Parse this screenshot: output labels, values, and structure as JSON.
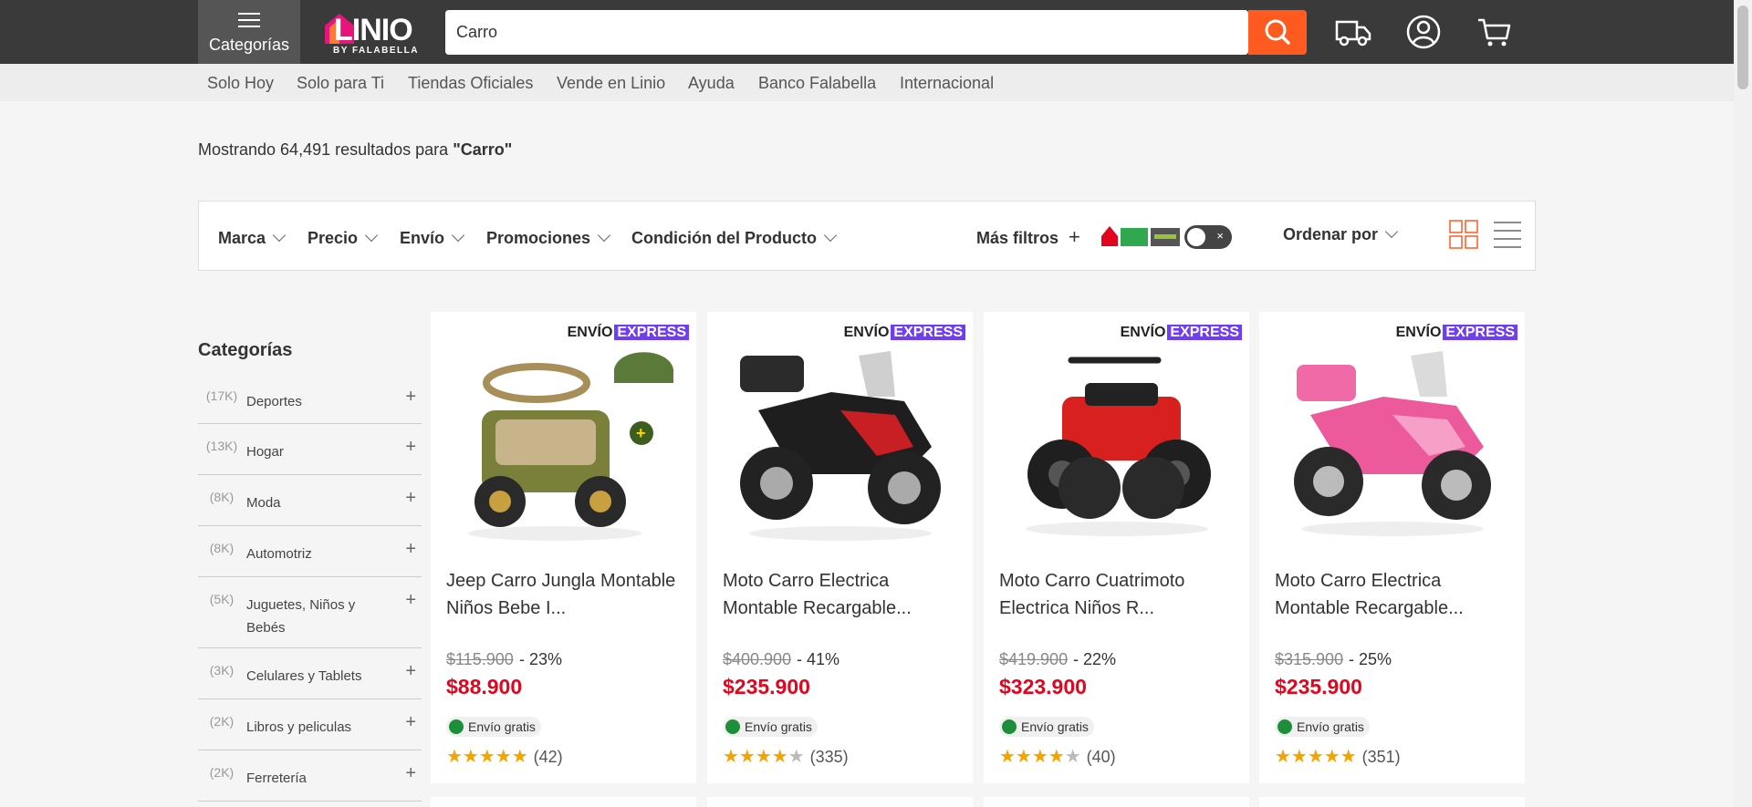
{
  "header": {
    "categories_label": "Categorías",
    "logo_text": "LINIO",
    "logo_sub": "BY FALABELLA",
    "search_value": "Carro"
  },
  "subnav": [
    "Solo Hoy",
    "Solo para Ti",
    "Tiendas Oficiales",
    "Vende en Linio",
    "Ayuda",
    "Banco Falabella",
    "Internacional"
  ],
  "results": {
    "prefix": "Mostrando 64,491 resultados para ",
    "query": "\"Carro\""
  },
  "filters": {
    "items": [
      "Marca",
      "Precio",
      "Envío",
      "Promociones",
      "Condición del Producto"
    ],
    "more": "Más filtros",
    "toggle_x": "×",
    "sort": "Ordenar por"
  },
  "sidebar": {
    "title": "Categorías",
    "items": [
      {
        "count": "(17K)",
        "name": "Deportes"
      },
      {
        "count": "(13K)",
        "name": "Hogar"
      },
      {
        "count": "(8K)",
        "name": "Moda"
      },
      {
        "count": "(8K)",
        "name": "Automotriz"
      },
      {
        "count": "(5K)",
        "name": "Juguetes, Niños y Bebés"
      },
      {
        "count": "(3K)",
        "name": "Celulares y Tablets"
      },
      {
        "count": "(2K)",
        "name": "Libros y peliculas"
      },
      {
        "count": "(2K)",
        "name": "Ferretería"
      }
    ]
  },
  "products": [
    {
      "badge_a": "ENVÍO",
      "badge_b": "EXPRESS",
      "title": "Jeep Carro Jungla Montable Niños Bebe I...",
      "old_price": "$115.900",
      "discount": "- 23%",
      "price": "$88.900",
      "shipping": "Envío gratis",
      "rating": 5,
      "reviews": "(42)"
    },
    {
      "badge_a": "ENVÍO",
      "badge_b": "EXPRESS",
      "title": "Moto Carro Electrica Montable Recargable...",
      "old_price": "$400.900",
      "discount": "- 41%",
      "price": "$235.900",
      "shipping": "Envío gratis",
      "rating": 4,
      "reviews": "(335)"
    },
    {
      "badge_a": "ENVÍO",
      "badge_b": "EXPRESS",
      "title": "Moto Carro Cuatrimoto Electrica Niños R...",
      "old_price": "$419.900",
      "discount": "- 22%",
      "price": "$323.900",
      "shipping": "Envío gratis",
      "rating": 4,
      "reviews": "(40)"
    },
    {
      "badge_a": "ENVÍO",
      "badge_b": "EXPRESS",
      "title": "Moto Carro Electrica Montable Recargable...",
      "old_price": "$315.900",
      "discount": "- 25%",
      "price": "$235.900",
      "shipping": "Envío gratis",
      "rating": 5,
      "reviews": "(351)"
    }
  ],
  "colors": {
    "header_bg": "#3a3a3a",
    "accent_orange": "#ff5a1f",
    "price_red": "#e1051e",
    "express_purple": "#6f3ef2",
    "star": "#f5a300",
    "free_shipping_green": "#1d8f3a"
  }
}
